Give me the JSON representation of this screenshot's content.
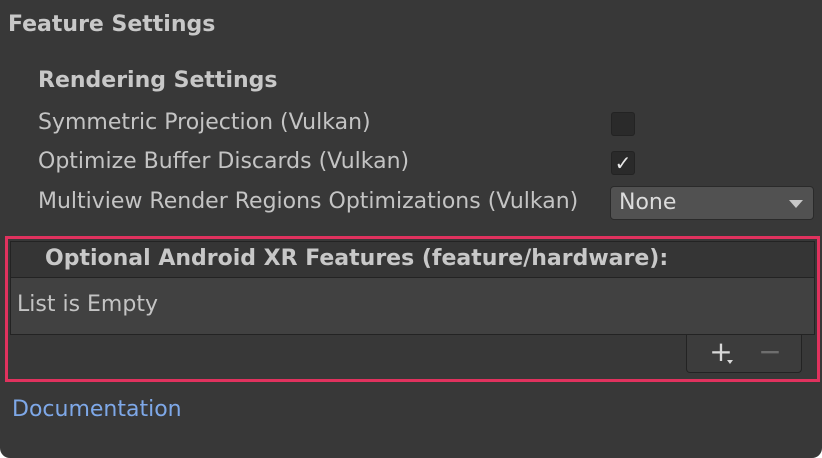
{
  "feature_settings": {
    "title": "Feature Settings",
    "rendering_settings": {
      "title": "Rendering Settings",
      "symmetric_projection": {
        "label": "Symmetric Projection (Vulkan)",
        "checked": false
      },
      "optimize_buffer_discards": {
        "label": "Optimize Buffer Discards (Vulkan)",
        "checked": true,
        "check_glyph": "✓"
      },
      "multiview_regions": {
        "label": "Multiview Render Regions Optimizations (Vulkan)",
        "selected": "None"
      }
    },
    "optional_features": {
      "header": "Optional Android XR Features (feature/hardware):",
      "empty_text": "List is Empty",
      "add_glyph": "+",
      "remove_glyph": "−"
    },
    "documentation_link": "Documentation"
  },
  "colors": {
    "panel_bg": "#383838",
    "highlight_border": "#e0325e",
    "link": "#7ea8e8"
  }
}
